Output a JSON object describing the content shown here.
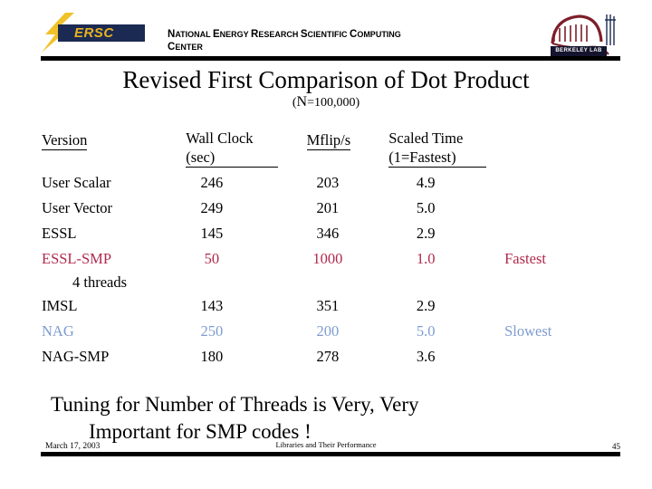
{
  "header": {
    "logo_name": "nersc-logo",
    "logo_text": "ERSC",
    "org_line1_cap": "N",
    "org_line1": "ATIONAL ",
    "org_name_full": "NATIONAL ENERGY RESEARCH SCIENTIFIC COMPUTING CENTER",
    "berkeley_lab_label": "BERKELEY LAB",
    "org_segments": [
      {
        "cap": "N",
        "rest": "ATIONAL"
      },
      {
        "cap": "E",
        "rest": "NERGY"
      },
      {
        "cap": "R",
        "rest": "ESEARCH"
      },
      {
        "cap": "S",
        "rest": "CIENTIFIC"
      },
      {
        "cap": "C",
        "rest": "OMPUTING"
      },
      {
        "cap": "C",
        "rest": "ENTER"
      }
    ]
  },
  "title": "Revised First Comparison of Dot Product",
  "subtitle_cap": "N",
  "subtitle_rest": "=100,000)",
  "subtitle_open": "(",
  "subtitle_full": "(N=100,000)",
  "table": {
    "headers": {
      "version": "Version",
      "wall_clock": "Wall Clock (sec)",
      "mflips": "Mflip/s",
      "scaled_time": "Scaled Time (1=Fastest)",
      "note": ""
    },
    "rows": [
      {
        "version": "User Scalar",
        "wall_clock": "246",
        "mflips": "203",
        "scaled_time": "4.9",
        "note": ""
      },
      {
        "version": "User Vector",
        "wall_clock": "249",
        "mflips": "201",
        "scaled_time": "5.0",
        "note": ""
      },
      {
        "version": "ESSL",
        "wall_clock": "145",
        "mflips": "346",
        "scaled_time": "2.9",
        "note": ""
      },
      {
        "version": "ESSL-SMP",
        "wall_clock": "50",
        "mflips": "1000",
        "scaled_time": "1.0",
        "note": "Fastest"
      },
      {
        "version": "4 threads",
        "wall_clock": "",
        "mflips": "",
        "scaled_time": "",
        "note": ""
      },
      {
        "version": "IMSL",
        "wall_clock": "143",
        "mflips": "351",
        "scaled_time": "2.9",
        "note": ""
      },
      {
        "version": "NAG",
        "wall_clock": "250",
        "mflips": "200",
        "scaled_time": "5.0",
        "note": "Slowest"
      },
      {
        "version": "NAG-SMP",
        "wall_clock": "180",
        "mflips": "278",
        "scaled_time": "3.6",
        "note": ""
      }
    ]
  },
  "takeaway_line1": "Tuning for Number of Threads is Very, Very",
  "takeaway_line2": "Important for SMP codes !",
  "footer": {
    "date": "March 17, 2003",
    "center": "Libraries and Their Performance",
    "page": "45"
  },
  "colors": {
    "fastest": "#b02a4c",
    "slowest": "#7e9cd0",
    "nersc_navy": "#1b2a52",
    "nersc_gold": "#e8b21f",
    "berkeley_red": "#7d1f2a",
    "rule": "#000000"
  }
}
